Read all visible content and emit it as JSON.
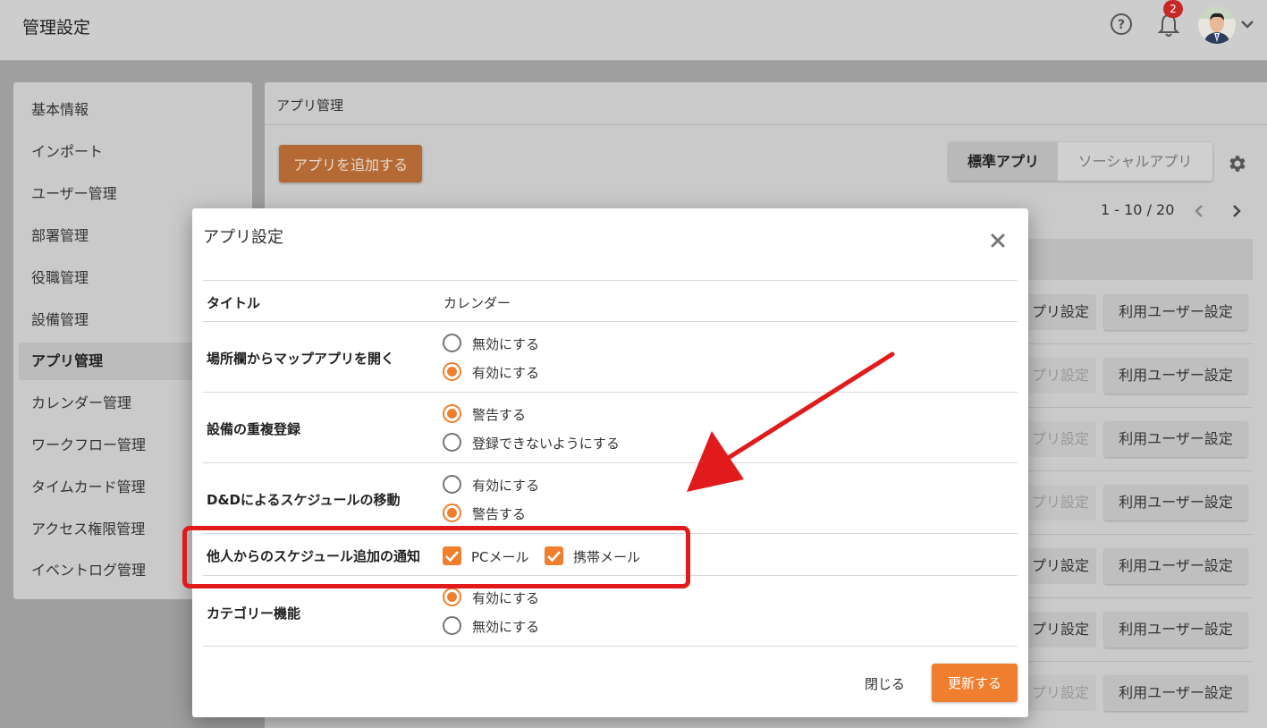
{
  "header": {
    "title": "管理設定",
    "notification_count": "2"
  },
  "sidebar": {
    "items": [
      {
        "label": "基本情報"
      },
      {
        "label": "インポート"
      },
      {
        "label": "ユーザー管理"
      },
      {
        "label": "部署管理"
      },
      {
        "label": "役職管理"
      },
      {
        "label": "設備管理"
      },
      {
        "label": "アプリ管理",
        "active": true
      },
      {
        "label": "カレンダー管理"
      },
      {
        "label": "ワークフロー管理"
      },
      {
        "label": "タイムカード管理"
      },
      {
        "label": "アクセス権限管理"
      },
      {
        "label": "イベントログ管理"
      }
    ]
  },
  "panel": {
    "title": "アプリ管理",
    "add_app_label": "アプリを追加する",
    "tabs": {
      "standard": "標準アプリ",
      "social": "ソーシャルアプリ"
    },
    "pagination": "1 - 10 / 20",
    "row_buttons": {
      "app_setting_partial": "プリ設定",
      "user_setting": "利用ユーザー設定"
    }
  },
  "modal": {
    "title": "アプリ設定",
    "rows": {
      "title": {
        "label": "タイトル",
        "value": "カレンダー"
      },
      "map": {
        "label": "場所欄からマップアプリを開く",
        "options": [
          "無効にする",
          "有効にする"
        ],
        "selected": 1
      },
      "duplicate": {
        "label": "設備の重複登録",
        "options": [
          "警告する",
          "登録できないようにする"
        ],
        "selected": 0
      },
      "dnd": {
        "label": "D&Dによるスケジュールの移動",
        "options": [
          "有効にする",
          "警告する"
        ],
        "selected": 1
      },
      "notify": {
        "label": "他人からのスケジュール追加の通知",
        "checks": [
          {
            "label": "PCメール",
            "checked": true
          },
          {
            "label": "携帯メール",
            "checked": true
          }
        ]
      },
      "category": {
        "label": "カテゴリー機能",
        "options": [
          "有効にする",
          "無効にする"
        ],
        "selected": 0
      }
    },
    "close_label": "閉じる",
    "update_label": "更新する"
  },
  "colors": {
    "accent": "#ef7f2f",
    "annotation": "#e11b1b"
  }
}
